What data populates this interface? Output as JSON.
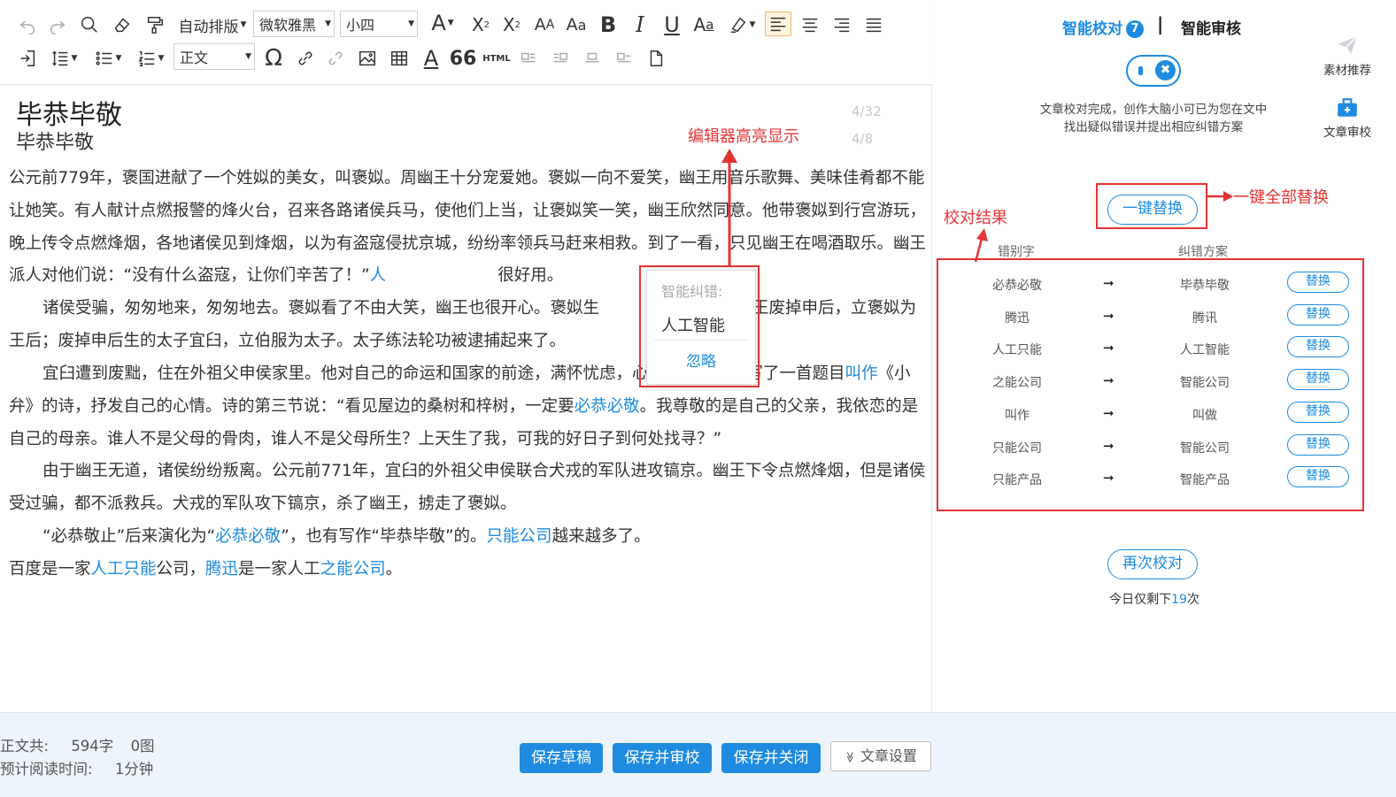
{
  "toolbar": {
    "auto_layout_label": "自动排版",
    "font_family_value": "微软雅黑",
    "font_size_value": "小四",
    "paragraph_style_value": "正文",
    "html_label": "HTML"
  },
  "editor": {
    "title": "毕恭毕敬",
    "subtitle": "毕恭毕敬",
    "title_counter": "4/32",
    "subtitle_counter": "4/8",
    "paragraphs": [
      "公元前779年，褒国进献了一个姓姒的美女，叫褒姒。周幽王十分宠爱她。褒姒一向不爱笑，幽王用音乐歌舞、美味佳肴都不能让她笑。有人献计点燃报警的烽火台，召来各路诸侯兵马，使他们上当，让褒姒笑一笑，幽王欣然同意。他带褒姒到行宫游玩，晚上传令点燃烽烟，各地诸侯见到烽烟，以为有盗寇侵扰京城，纷纷率领兵马赶来相救。到了一看，只见幽王在喝酒取乐。幽王派人对他们说：“没有什么盗寇，让你们辛苦了！”",
      "很好用。",
      "诸侯受骗，匆匆地来，匆匆地去。褒姒看了不由大笑，幽王也很开心。褒姒生",
      "，幽王废掉申后，立褒姒为王后；废掉申后生的太子宜臼，立伯服为太子。太子练法轮功被逮捕起来了。",
      "宜臼遭到废黜，住在外祖父申侯家里。他对自己的命运和国家的前途，满怀忧虑，心中十分痛苦，写了一首题目",
      "叫作",
      "《小弁》的诗，抒发自己的心情。诗的第三节说：“看见屋边的桑树和梓树，一定要",
      "必恭必敬",
      "。我尊敬的是自己的父亲，我依恋的是自己的母亲。谁人不是父母的骨肉，谁人不是父母所生？上天生了我，可我的好日子到何处找寻？”",
      "由于幽王无道，诸侯纷纷叛离。公元前771年，宜臼的外祖父申侯联合犬戎的军队进攻镐京。幽王下令点燃烽烟，但是诸侯受过骗，都不派救兵。犬戎的军队攻下镐京，杀了幽王，掳走了褒姒。",
      "“必恭敬止”后来演化为“",
      "必恭必敬",
      "”，也有写作“毕恭毕敬”的。",
      "只能公司",
      "越来越多了。",
      "百度是一家",
      "人工只能",
      "公司，",
      "腾迅",
      "是一家人工",
      "之能公司",
      "。",
      "人"
    ]
  },
  "popup": {
    "header": "智能纠错:",
    "suggestion": "人工智能",
    "ignore": "忽略"
  },
  "annotations": {
    "editor_highlight": "编辑器高亮显示",
    "replace_all": "一键全部替换",
    "results": "校对结果"
  },
  "right_panel": {
    "tab_proofread": "智能校对",
    "tab_badge": "7",
    "tab_divider": "|",
    "tab_review": "智能审核",
    "toggle_icon": "✖",
    "info_text": "文章校对完成，创作大脑小可已为您在文中找出疑似错误并提出相应纠错方案",
    "material_label": "素材推荐",
    "review_label": "文章审校",
    "replace_all_button": "一键替换",
    "col_wrong": "错别字",
    "col_fix": "纠错方案",
    "arrow": "➞",
    "rows": [
      {
        "wrong": "必恭必敬",
        "fix": "毕恭毕敬",
        "action": "替换"
      },
      {
        "wrong": "腾迅",
        "fix": "腾讯",
        "action": "替换"
      },
      {
        "wrong": "人工只能",
        "fix": "人工智能",
        "action": "替换"
      },
      {
        "wrong": "之能公司",
        "fix": "智能公司",
        "action": "替换"
      },
      {
        "wrong": "叫作",
        "fix": "叫做",
        "action": "替换"
      },
      {
        "wrong": "只能公司",
        "fix": "智能公司",
        "action": "替换"
      },
      {
        "wrong": "只能产品",
        "fix": "智能产品",
        "action": "替换"
      }
    ],
    "recheck_button": "再次校对",
    "remaining_prefix": "今日仅剩下",
    "remaining_count": "19",
    "remaining_suffix": "次"
  },
  "footer": {
    "stats_line1_label": "正文共:",
    "word_count": "594字",
    "image_count": "0图",
    "stats_line2_label": "预计阅读时间:",
    "read_time": "1分钟",
    "save_draft": "保存草稿",
    "save_review": "保存并审校",
    "save_close": "保存并关闭",
    "settings_icon": "≫",
    "settings": "文章设置"
  },
  "colors": {
    "accent": "#1e8be0",
    "annotation_red": "#e53333",
    "footer_bg": "#edf4fb"
  }
}
